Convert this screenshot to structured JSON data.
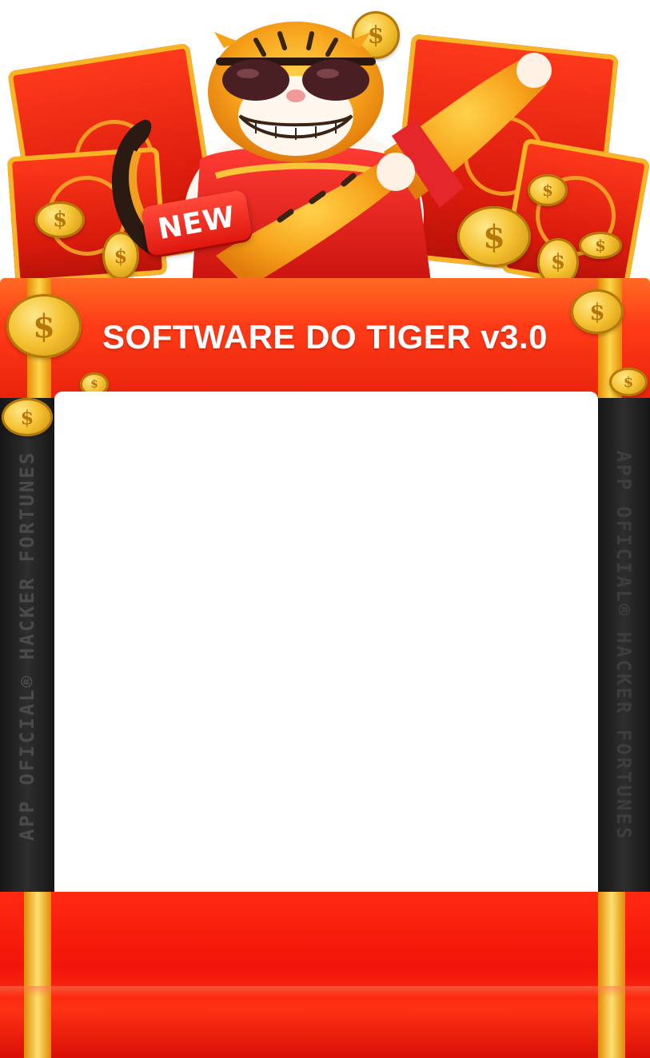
{
  "hero": {
    "badge_text": "NEW",
    "tiger_icon": "tiger-mascot-icon",
    "coin_symbol": "$"
  },
  "banner": {
    "title": "SOFTWARE DO TIGER v3.0"
  },
  "rails": {
    "left_text": "APP OFICIAL® HACKER FORTUNES",
    "right_text": "APP OFICIAL® HACKER FORTUNES"
  },
  "colors": {
    "brand_red": "#e9240c",
    "gold": "#f5c232",
    "rail_dark": "#1c1c1c"
  }
}
